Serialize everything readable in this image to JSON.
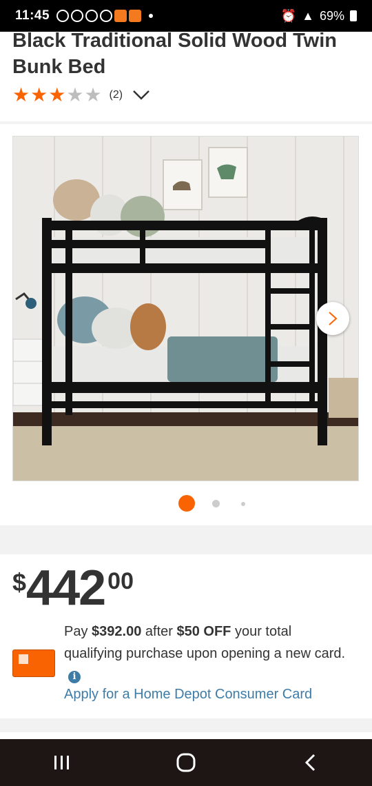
{
  "status_bar": {
    "time": "11:45",
    "battery": "69%"
  },
  "product": {
    "title": "Black Traditional Solid Wood Twin Bunk Bed",
    "rating_stars": 3,
    "rating_max": 5,
    "review_count": "(2)"
  },
  "gallery": {
    "image_count": 3,
    "active_index": 0
  },
  "price": {
    "symbol": "$",
    "dollars": "442",
    "cents": "00"
  },
  "offer": {
    "pay": "Pay",
    "discounted_price": "$392.00",
    "after": "after",
    "discount": "$50 OFF",
    "rest": "your total qualifying purchase upon opening a new card.",
    "apply_link": "Apply for a Home Depot Consumer Card"
  },
  "colors": {
    "accent": "#f96302",
    "link": "#3e7ca8"
  }
}
